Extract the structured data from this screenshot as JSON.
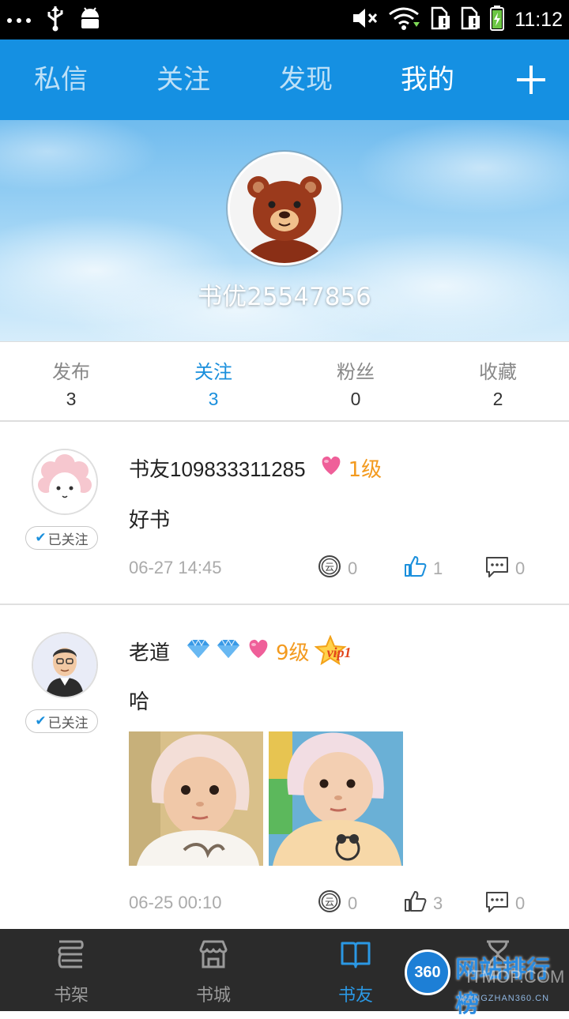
{
  "status_bar": {
    "time": "11:12"
  },
  "top_tabs": [
    {
      "label": "私信",
      "active": false
    },
    {
      "label": "关注",
      "active": false
    },
    {
      "label": "发现",
      "active": false
    },
    {
      "label": "我的",
      "active": true
    }
  ],
  "profile": {
    "username": "书优25547856"
  },
  "stats": [
    {
      "label": "发布",
      "value": "3",
      "active": false
    },
    {
      "label": "关注",
      "value": "3",
      "active": true
    },
    {
      "label": "粉丝",
      "value": "0",
      "active": false
    },
    {
      "label": "收藏",
      "value": "2",
      "active": false
    }
  ],
  "posts": [
    {
      "author": "书友109833311285",
      "level": "1级",
      "follow_label": "已关注",
      "text": "好书",
      "time": "06-27 14:45",
      "coins": "0",
      "likes": "1",
      "comments": "0",
      "liked": true
    },
    {
      "author": "老道",
      "level": "9级",
      "vip": "vip1",
      "follow_label": "已关注",
      "text": "哈",
      "time": "06-25 00:10",
      "coins": "0",
      "likes": "3",
      "comments": "0",
      "liked": false
    }
  ],
  "coin_glyph": "云",
  "bottom_nav": [
    {
      "label": "书架",
      "icon": "bookshelf-icon",
      "active": false
    },
    {
      "label": "书城",
      "icon": "store-icon",
      "active": false
    },
    {
      "label": "书友",
      "icon": "open-book-icon",
      "active": true
    },
    {
      "label": "",
      "icon": "hourglass-icon",
      "active": false
    }
  ],
  "watermark": {
    "badge": "360",
    "text": "网站排行榜",
    "overlay": "ITMOP.COM",
    "small": "WANGZHAN360.CN"
  },
  "colors": {
    "primary": "#1590e2",
    "accent": "#1a8fdc",
    "level": "#f39a1e",
    "nav_bg": "#2b2b2b"
  }
}
